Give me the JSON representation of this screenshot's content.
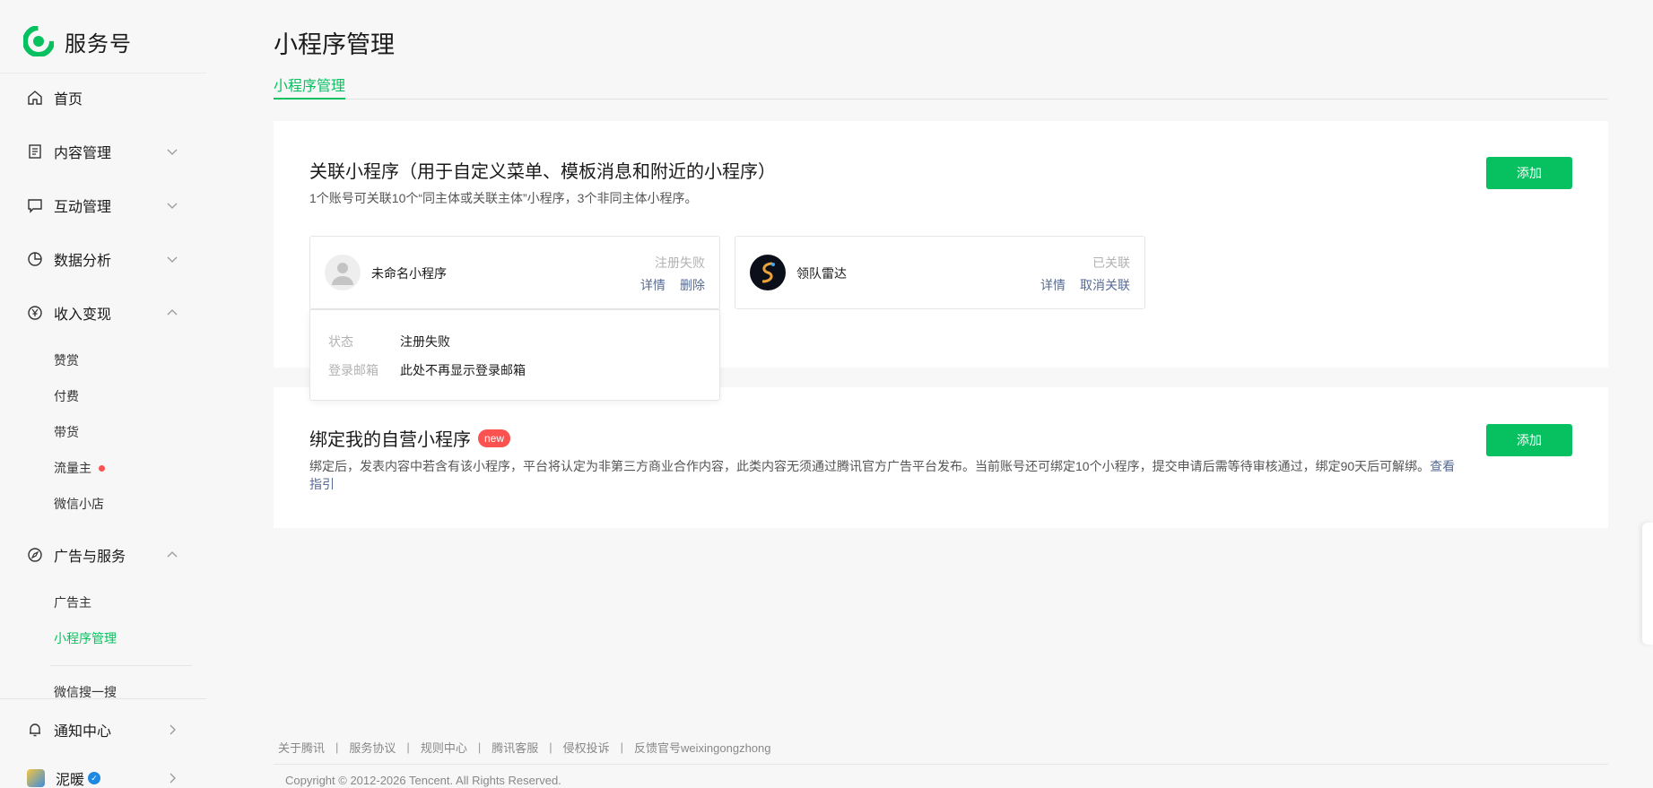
{
  "brand": {
    "name": "服务号"
  },
  "sidebar": {
    "home": "首页",
    "content": "内容管理",
    "interaction": "互动管理",
    "analytics": "数据分析",
    "revenue": "收入变现",
    "revenue_items": [
      "赞赏",
      "付费",
      "带货",
      "流量主",
      "微信小店"
    ],
    "ads": "广告与服务",
    "ads_items": [
      "广告主",
      "小程序管理",
      "微信搜一搜"
    ],
    "notifications": "通知中心",
    "account_name": "泥暖"
  },
  "page": {
    "title": "小程序管理",
    "tab": "小程序管理"
  },
  "linked": {
    "title": "关联小程序（用于自定义菜单、模板消息和附近的小程序）",
    "desc": "1个账号可关联10个“同主体或关联主体”小程序，3个非同主体小程序。",
    "add_label": "添加",
    "items": [
      {
        "name": "未命名小程序",
        "status": "注册失败",
        "action1": "详情",
        "action2": "删除"
      },
      {
        "name": "领队雷达",
        "status": "已关联",
        "action1": "详情",
        "action2": "取消关联"
      }
    ],
    "popover": {
      "status_label": "状态",
      "status_value": "注册失败",
      "email_label": "登录邮箱",
      "email_value": "此处不再显示登录邮箱"
    }
  },
  "bound": {
    "title": "绑定我的自营小程序",
    "badge": "new",
    "desc": "绑定后，发表内容中若含有该小程序，平台将认定为非第三方商业合作内容，此类内容无须通过腾讯官方广告平台发布。当前账号还可绑定10个小程序，提交申请后需等待审核通过，绑定90天后可解绑。",
    "guide_link": "查看指引",
    "add_label": "添加"
  },
  "footer": {
    "links": [
      "关于腾讯",
      "服务协议",
      "规则中心",
      "腾讯客服",
      "侵权投诉",
      "反馈官号weixingongzhong"
    ],
    "separator": "|",
    "copyright": "Copyright © 2012-2026 Tencent. All Rights Reserved."
  },
  "colors": {
    "accent": "#07c160",
    "link": "#576b95",
    "danger": "#fa5151"
  }
}
